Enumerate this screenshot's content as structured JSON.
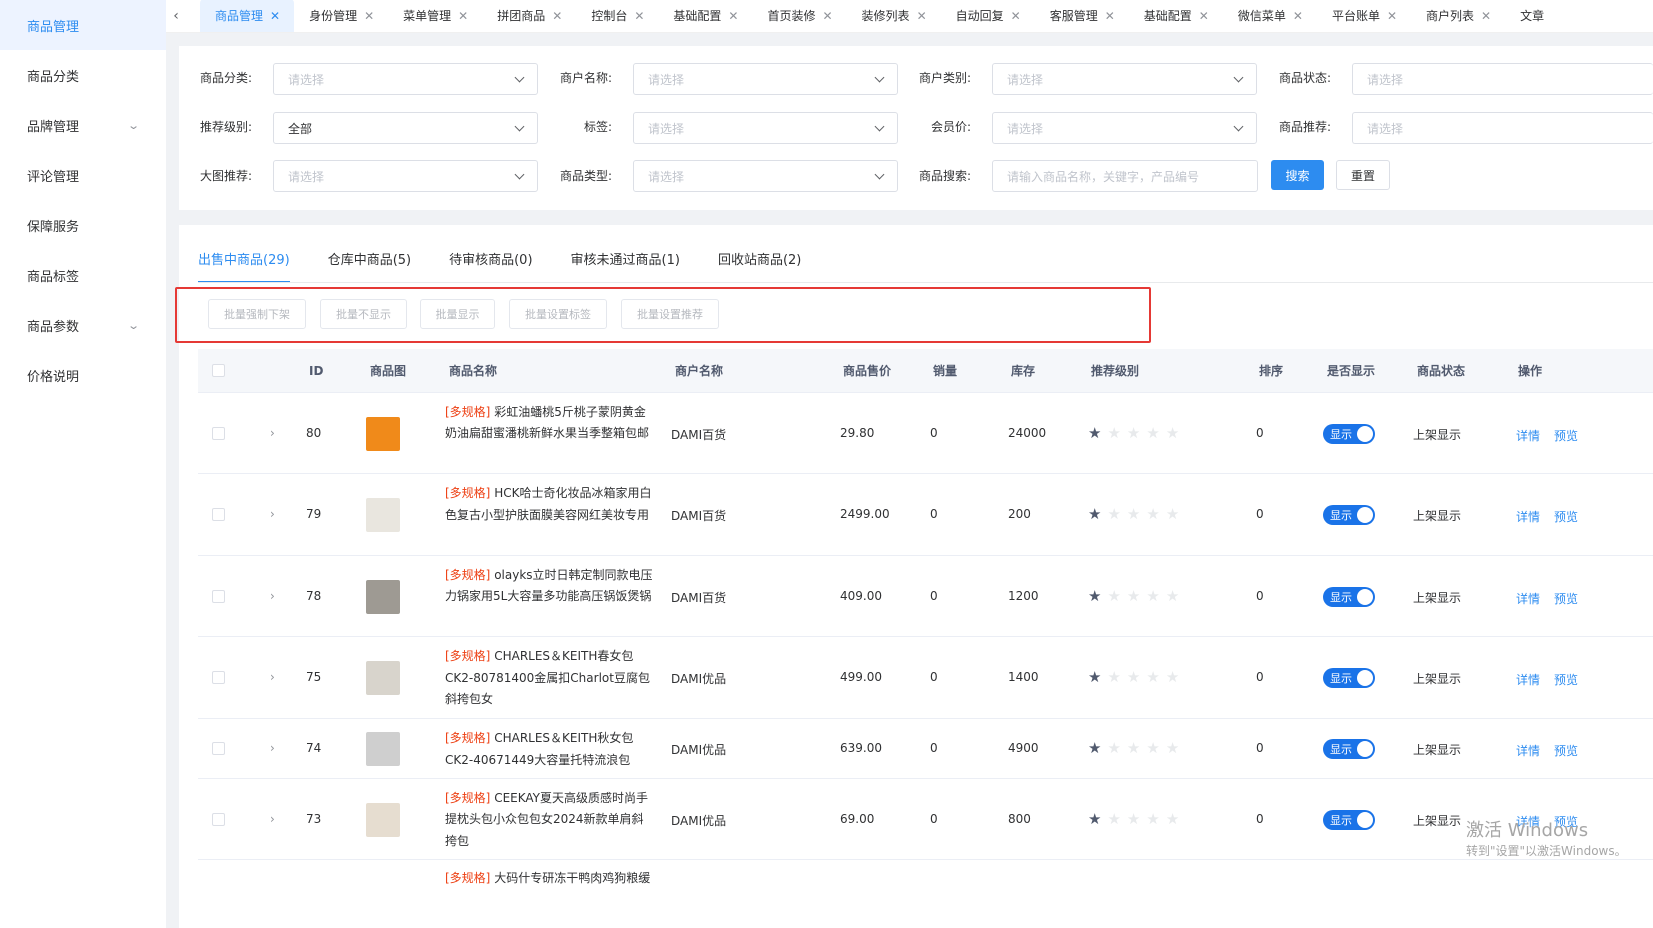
{
  "sidebar": {
    "items": [
      {
        "label": "商品管理",
        "active": true,
        "has_children": false
      },
      {
        "label": "商品分类",
        "active": false,
        "has_children": false
      },
      {
        "label": "品牌管理",
        "active": false,
        "has_children": true
      },
      {
        "label": "评论管理",
        "active": false,
        "has_children": false
      },
      {
        "label": "保障服务",
        "active": false,
        "has_children": false
      },
      {
        "label": "商品标签",
        "active": false,
        "has_children": false
      },
      {
        "label": "商品参数",
        "active": false,
        "has_children": true
      },
      {
        "label": "价格说明",
        "active": false,
        "has_children": false
      }
    ]
  },
  "tabs": [
    "商品管理",
    "身份管理",
    "菜单管理",
    "拼团商品",
    "控制台",
    "基础配置",
    "首页装修",
    "装修列表",
    "自动回复",
    "客服管理",
    "基础配置",
    "微信菜单",
    "平台账单",
    "商户列表",
    "文章"
  ],
  "filters": {
    "category_label": "商品分类:",
    "category_placeholder": "请选择",
    "merchant_name_label": "商户名称:",
    "merchant_name_placeholder": "请选择",
    "merchant_type_label": "商户类别:",
    "merchant_type_placeholder": "请选择",
    "status_label": "商品状态:",
    "status_placeholder": "请选择",
    "rec_level_label": "推荐级别:",
    "rec_level_value": "全部",
    "tag_label": "标签:",
    "tag_placeholder": "请选择",
    "member_price_label": "会员价:",
    "member_price_placeholder": "请选择",
    "product_rec_label": "商品推荐:",
    "product_rec_placeholder": "请选择",
    "big_img_label": "大图推荐:",
    "big_img_placeholder": "请选择",
    "product_type_label": "商品类型:",
    "product_type_placeholder": "请选择",
    "search_label": "商品搜索:",
    "search_placeholder": "请输入商品名称，关键字，产品编号",
    "search_button": "搜索",
    "reset_button": "重置"
  },
  "product_tabs": [
    {
      "label": "出售中商品(29)",
      "active": true
    },
    {
      "label": "仓库中商品(5)",
      "active": false
    },
    {
      "label": "待审核商品(0)",
      "active": false
    },
    {
      "label": "审核未通过商品(1)",
      "active": false
    },
    {
      "label": "回收站商品(2)",
      "active": false
    }
  ],
  "batch_buttons": [
    "批量强制下架",
    "批量不显示",
    "批量显示",
    "批量设置标签",
    "批量设置推荐"
  ],
  "table": {
    "headers": {
      "id": "ID",
      "image": "商品图",
      "name": "商品名称",
      "merchant": "商户名称",
      "price": "商品售价",
      "sales": "销量",
      "stock": "库存",
      "rec_level": "推荐级别",
      "sort": "排序",
      "show": "是否显示",
      "status": "商品状态",
      "ops": "操作"
    },
    "rows": [
      {
        "id": "80",
        "tag": "[多规格]",
        "name": "彩虹油蟠桃5斤桃子蒙阴黄金奶油扁甜蜜潘桃新鲜水果当季整箱包邮",
        "merchant": "DAMI百货",
        "price": "29.80",
        "sales": "0",
        "stock": "24000",
        "stars": 1,
        "sort": "0",
        "show": "显示",
        "status": "上架显示",
        "detail": "详情",
        "preview": "预览",
        "thumb_color": "#f08a1a"
      },
      {
        "id": "79",
        "tag": "[多规格]",
        "name": "HCK哈士奇化妆品冰箱家用白色复古小型护肤面膜美容网红美妆专用",
        "merchant": "DAMI百货",
        "price": "2499.00",
        "sales": "0",
        "stock": "200",
        "stars": 1,
        "sort": "0",
        "show": "显示",
        "status": "上架显示",
        "detail": "详情",
        "preview": "预览",
        "thumb_color": "#e9e6df"
      },
      {
        "id": "78",
        "tag": "[多规格]",
        "name": "olayks立时日韩定制同款电压力锅家用5L大容量多功能高压锅饭煲锅",
        "merchant": "DAMI百货",
        "price": "409.00",
        "sales": "0",
        "stock": "1200",
        "stars": 1,
        "sort": "0",
        "show": "显示",
        "status": "上架显示",
        "detail": "详情",
        "preview": "预览",
        "thumb_color": "#9e9a93"
      },
      {
        "id": "75",
        "tag": "[多规格]",
        "name": "CHARLES＆KEITH春女包CK2-80781400金属扣Charlot豆腐包斜挎包女",
        "merchant": "DAMI优品",
        "price": "499.00",
        "sales": "0",
        "stock": "1400",
        "stars": 1,
        "sort": "0",
        "show": "显示",
        "status": "上架显示",
        "detail": "详情",
        "preview": "预览",
        "thumb_color": "#d8d4cc"
      },
      {
        "id": "74",
        "tag": "[多规格]",
        "name": "CHARLES＆KEITH秋女包CK2-40671449大容量托特流浪包",
        "merchant": "DAMI优品",
        "price": "639.00",
        "sales": "0",
        "stock": "4900",
        "stars": 1,
        "sort": "0",
        "show": "显示",
        "status": "上架显示",
        "detail": "详情",
        "preview": "预览",
        "thumb_color": "#cfcfcf"
      },
      {
        "id": "73",
        "tag": "[多规格]",
        "name": "CEEKAY夏天高级质感时尚手提枕头包小众包包女2024新款单肩斜挎包",
        "merchant": "DAMI优品",
        "price": "69.00",
        "sales": "0",
        "stock": "800",
        "stars": 1,
        "sort": "0",
        "show": "显示",
        "status": "上架显示",
        "detail": "详情",
        "preview": "预览",
        "thumb_color": "#e6ddd0"
      }
    ],
    "partial_row": {
      "tag": "[多规格]",
      "name": "大码什专研冻干鸭肉鸡狗粮缓"
    }
  },
  "watermark": {
    "line1": "激活 Windows",
    "line2": "转到\"设置\"以激活Windows。"
  }
}
